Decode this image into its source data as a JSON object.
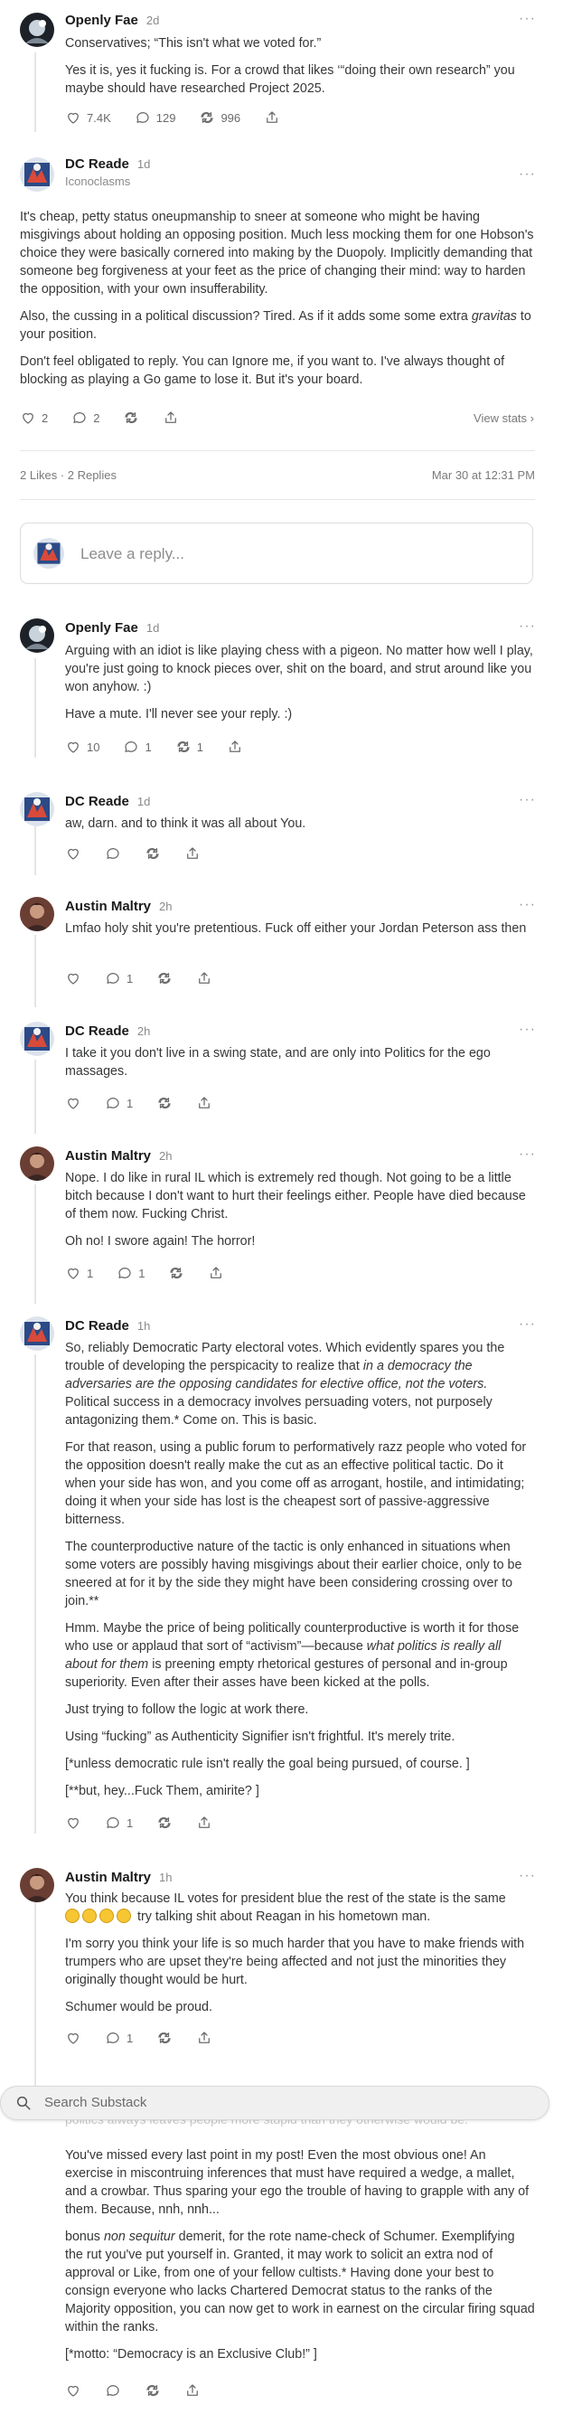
{
  "comments": [
    {
      "author": "Openly Fae",
      "time": "2d",
      "paragraphs": [
        "Conservatives; “This isn't what we voted for.”",
        "Yes it is, yes it fucking is. For a crowd that likes ‘“doing their own research” you maybe should have researched Project 2025."
      ],
      "likes": "7.4K",
      "replies": "129",
      "restacks": "996"
    },
    {
      "author": "DC Reade",
      "time": "1d",
      "subtitle": "Iconoclasms",
      "paragraphs": [
        "It's cheap, petty status oneupmanship to sneer at someone who might be having misgivings about holding an opposing position. Much less mocking them for one Hobson's choice they were basically cornered into making by the Duopoly. Implicitly demanding that someone beg forgiveness at your feet as the price of changing their mind: way to harden the opposition, with your own insufferability.",
        "Also, the cussing in a political discussion? Tired. As if it adds some some extra",
        "gravitas",
        " to your position.",
        "Don't feel obligated to reply. You can Ignore me, if you want to. I've always thought of blocking as playing a Go game to lose it. But it's your board."
      ],
      "likes": "2",
      "replies": "2",
      "view_stats": "View stats"
    },
    {
      "author": "Openly Fae",
      "time": "1d",
      "paragraphs": [
        "Arguing with an idiot is like playing chess with a pigeon. No matter how well I play, you're just going to knock pieces over, shit on the board, and strut around like you won anyhow. :)",
        "Have a mute. I'll never see your reply. :)"
      ],
      "likes": "10",
      "replies": "1",
      "restacks": "1"
    },
    {
      "author": "DC Reade",
      "time": "1d",
      "paragraphs": [
        "aw, darn. and to think it was all about You."
      ]
    },
    {
      "author": "Austin Maltry",
      "time": "2h",
      "paragraphs": [
        "Lmfao holy shit you're pretentious. Fuck off either your Jordan Peterson ass then"
      ],
      "replies": "1"
    },
    {
      "author": "DC Reade",
      "time": "2h",
      "paragraphs": [
        "I take it you don't live in a swing state, and are only into Politics for the ego massages."
      ],
      "replies": "1"
    },
    {
      "author": "Austin Maltry",
      "time": "2h",
      "paragraphs": [
        "Nope. I do like in rural IL which is extremely red though. Not going to be a little bitch because I don't want to hurt their feelings either. People have died because of them now. Fucking Christ.",
        "Oh no! I swore again! The horror!"
      ],
      "likes": "1",
      "replies": "1"
    },
    {
      "author": "DC Reade",
      "time": "1h",
      "paragraphs": [
        "So, reliably Democratic Party electoral votes. Which evidently spares you the trouble of developing the perspicacity to realize that",
        "in a democracy the adversaries are the opposing candidates for elective office, not the voters.",
        "Political success in a democracy involves persuading voters, not purposely antagonizing them.* Come on. This is basic.",
        "For that reason, using a public forum to performatively razz people who voted for the opposition doesn't really make the cut as an effective political tactic. Do it when your side has won, and you come off as arrogant, hostile, and intimidating; doing it when your side has lost is the cheapest sort of passive-aggressive bitterness.",
        "The counterproductive nature of the tactic is only enhanced in situations when some voters are possibly having misgivings about their earlier choice, only to be sneered at for it by the side they might have been considering crossing over to join.**",
        "Hmm. Maybe the price of being politically counterproductive is worth it for those who use or applaud that sort of “activism”—because",
        "what politics is really all about for them",
        "is preening empty rhetorical gestures of personal and in-group superiority. Even after their asses have been kicked at the polls.",
        "Just trying to follow the logic at work there.",
        "Using “fucking” as Authenticity Signifier isn't frightful. It's merely trite.",
        "[*unless democratic rule isn't really the goal being pursued, of course. ]",
        "[**but, hey...Fuck Them, amirite? ]"
      ],
      "replies": "1"
    },
    {
      "author": "Austin Maltry",
      "time": "1h",
      "paragraphs": [
        "You think because IL votes for president blue the rest of the state is the same",
        "try talking shit about Reagan in his hometown man.",
        "I'm sorry you think your life is so much harder that you have to make friends with trumpers who are upset they're being affected and not just the minorities they originally thought would be hurt.",
        "Schumer would be proud."
      ],
      "replies": "1"
    },
    {
      "paragraphs": [
        "You've missed every last point in my post! Even the most obvious one! An exercise in miscontruing inferences that must have required a wedge, a mallet, and a crowbar. Thus sparing your ego the trouble of having to grapple with any of them. Because, nnh, nnh...",
        "bonus",
        "non sequitur",
        "demerit, for the rote name-check of Schumer. Exemplifying the rut you've put yourself in. Granted, it may work to solicit an extra nod of approval or Like, from one of your fellow cultists.* Having done your best to consign everyone who lacks Chartered Democrat status to the ranks of the Majority opposition, you can now get to work in earnest on the circular firing squad within the ranks.",
        "[*motto: “Democracy is an Exclusive Club!” ]"
      ]
    }
  ],
  "thread_meta": {
    "counts": "2 Likes · 2 Replies",
    "date": "Mar 30 at 12:31 PM"
  },
  "reply_placeholder": "Leave a reply...",
  "search_placeholder": "Search Substack",
  "ghost_text": "politics always leaves people more stupid than they otherwise would be.",
  "icons": [
    "heart-icon",
    "comment-icon",
    "restack-icon",
    "share-icon",
    "search-icon",
    "more-icon"
  ],
  "colors": {
    "text": "#363737",
    "muted": "#8a8a8a",
    "divider": "#e6e6e6",
    "search_bg": "#f0f0f0"
  }
}
